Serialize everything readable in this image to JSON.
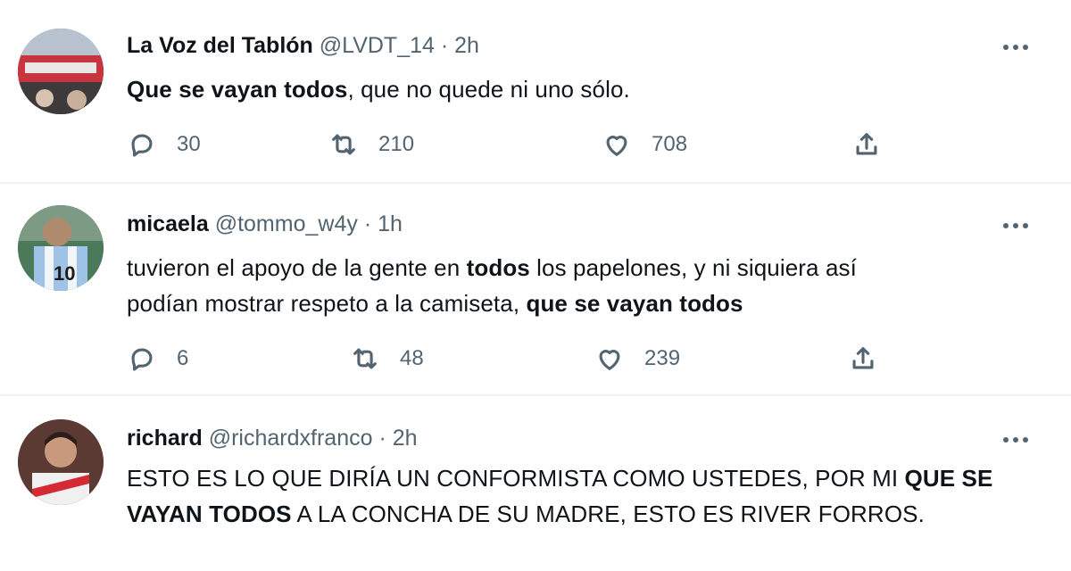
{
  "tweets": [
    {
      "name": "La Voz del Tablón",
      "handle": "@LVDT_14",
      "dot": "·",
      "time": "2h",
      "text_parts": [
        {
          "text": "Que se vayan todos",
          "bold": true
        },
        {
          "text": ", que no quede ni uno sólo.",
          "bold": false
        }
      ],
      "replies": "30",
      "retweets": "210",
      "likes": "708"
    },
    {
      "name": "micaela",
      "handle": "@tommo_w4y",
      "dot": "·",
      "time": "1h",
      "text_parts": [
        {
          "text": "tuvieron el apoyo de la gente en ",
          "bold": false
        },
        {
          "text": "todos",
          "bold": true
        },
        {
          "text": " los papelones, y ni siquiera así podían mostrar respeto a la camiseta, ",
          "bold": false
        },
        {
          "text": "que se vayan todos",
          "bold": true
        }
      ],
      "replies": "6",
      "retweets": "48",
      "likes": "239"
    },
    {
      "name": "richard",
      "handle": "@richardxfranco",
      "dot": "·",
      "time": "2h",
      "text_parts": [
        {
          "text": "ESTO ES LO QUE DIRÍA UN CONFORMISTA COMO USTEDES, POR MI ",
          "bold": false
        },
        {
          "text": "QUE SE VAYAN TODOS",
          "bold": true
        },
        {
          "text": " A LA CONCHA DE SU MADRE, ESTO ES RIVER FORROS.",
          "bold": false
        }
      ]
    }
  ],
  "icons": {
    "reply": "reply-icon",
    "retweet": "retweet-icon",
    "like": "heart-icon",
    "share": "share-icon",
    "more": "more-icon"
  },
  "colors": {
    "text": "#0f1419",
    "muted": "#536471",
    "divider": "#eff3f4"
  }
}
